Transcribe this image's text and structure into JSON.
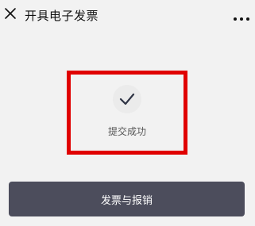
{
  "header": {
    "title": "开具电子发票",
    "close_icon": "close-icon",
    "more_icon": "more-icon"
  },
  "result": {
    "icon": "checkmark-icon",
    "status_text": "提交成功",
    "highlight_color": "#e00000"
  },
  "actions": {
    "primary_label": "发票与报销",
    "primary_color": "#4c4d5c"
  }
}
